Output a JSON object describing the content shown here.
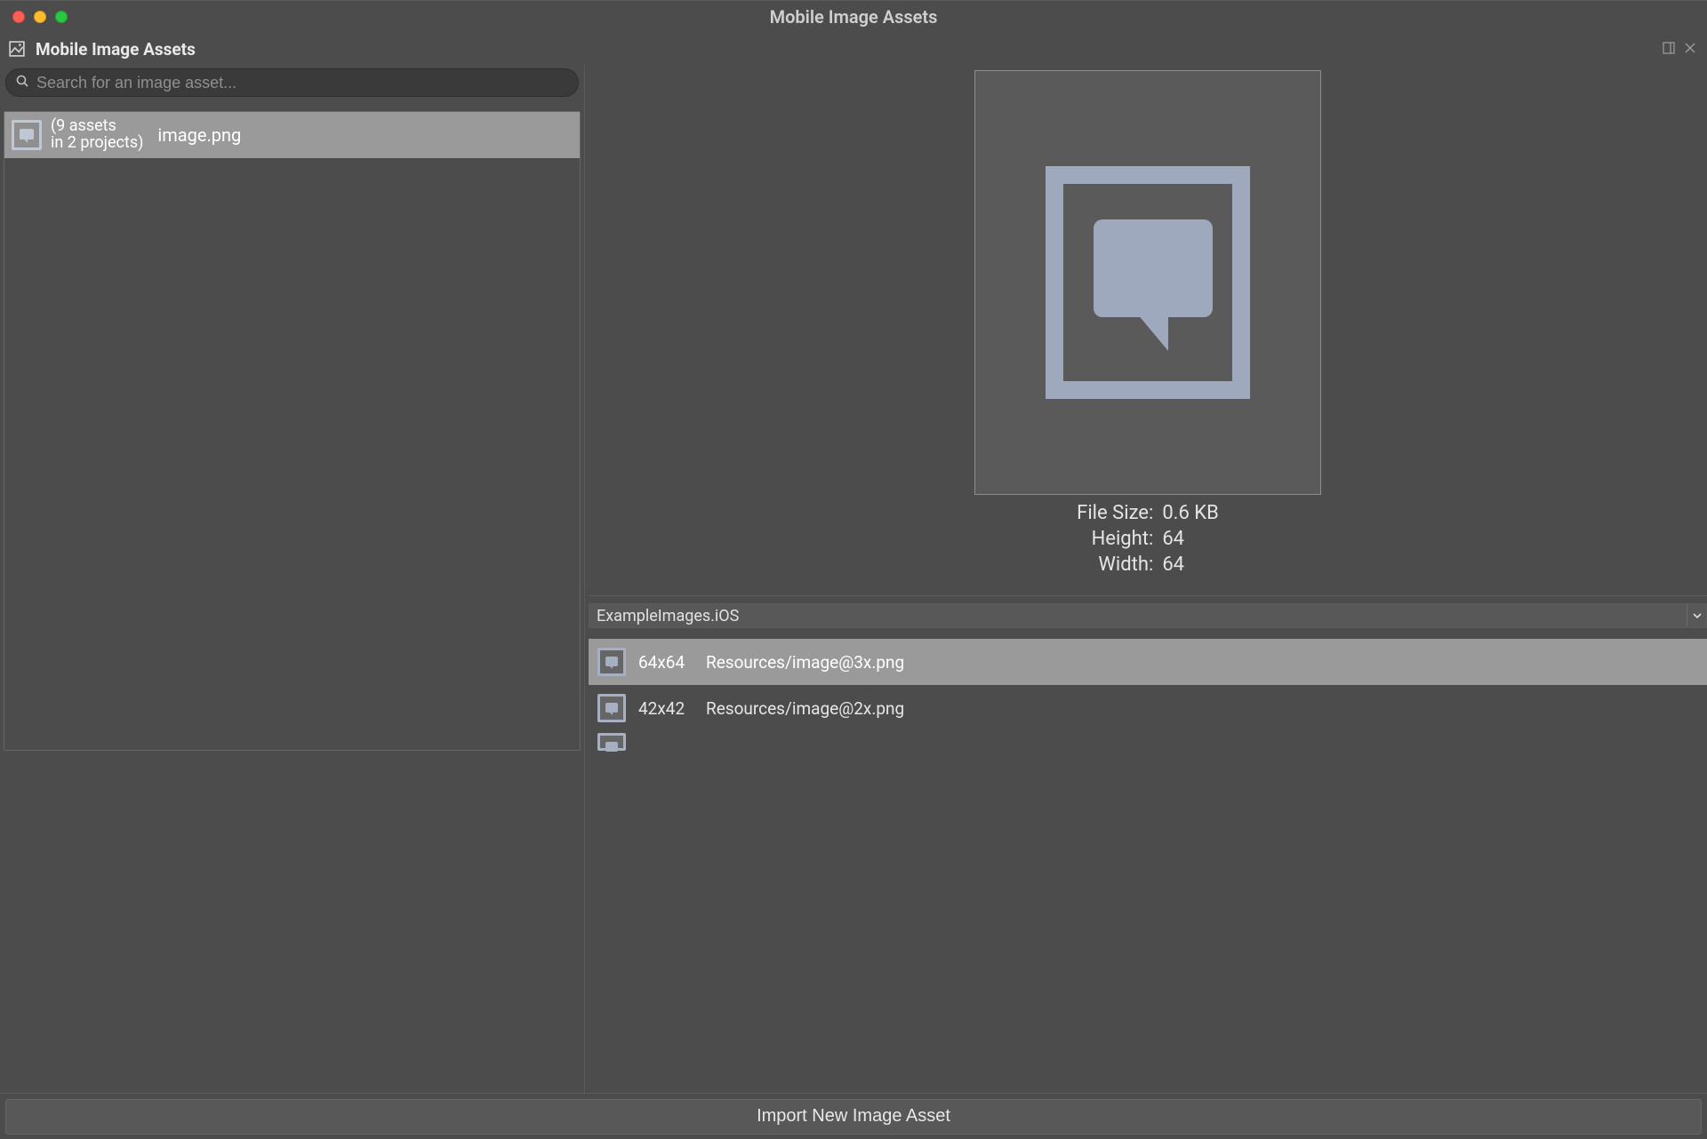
{
  "window": {
    "title": "Mobile Image Assets"
  },
  "panel": {
    "title": "Mobile Image Assets"
  },
  "search": {
    "placeholder": "Search for an image asset..."
  },
  "asset_list": {
    "items": [
      {
        "count_line1": "(9 assets",
        "count_line2": "in 2 projects)",
        "name": "image.png",
        "selected": true
      }
    ]
  },
  "preview": {
    "file_size_label": "File Size:",
    "file_size": "0.6 KB",
    "height_label": "Height:",
    "height": "64",
    "width_label": "Width:",
    "width": "64"
  },
  "project_select": {
    "value": "ExampleImages.iOS"
  },
  "variants": [
    {
      "size": "64x64",
      "path": "Resources/image@3x.png",
      "selected": true
    },
    {
      "size": "42x42",
      "path": "Resources/image@2x.png",
      "selected": false
    }
  ],
  "footer": {
    "import_label": "Import New Image Asset"
  }
}
